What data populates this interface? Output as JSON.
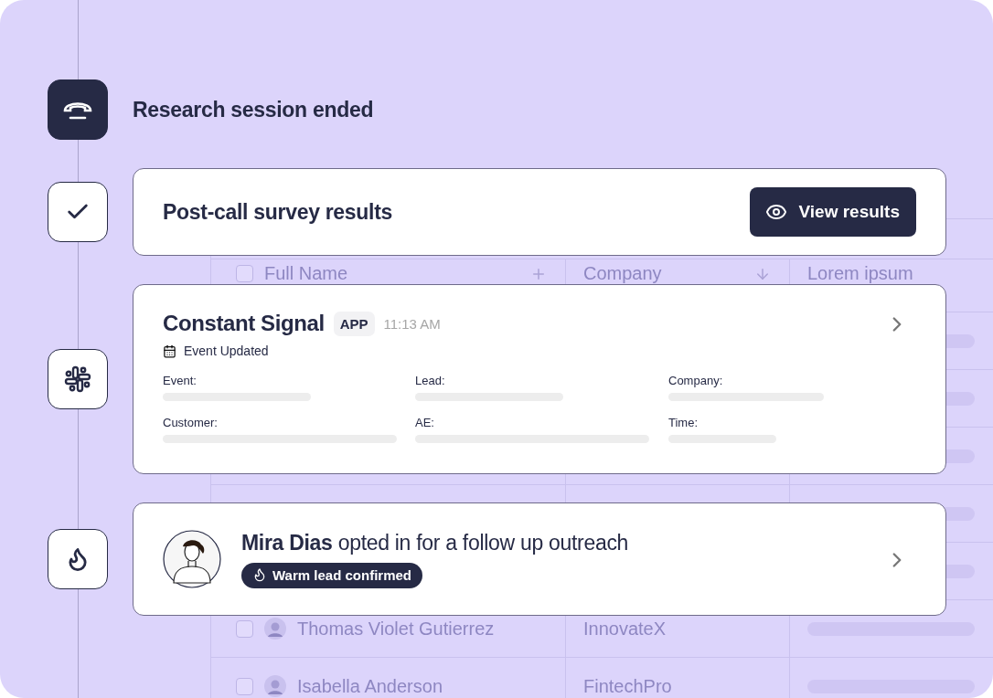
{
  "timeline": [
    {
      "kind": "status",
      "title": "Research session ended"
    },
    {
      "kind": "survey",
      "title": "Post-call survey results",
      "button": "View results"
    },
    {
      "kind": "event",
      "app": "Constant Signal",
      "badge": "APP",
      "time": "11:13 AM",
      "event": "Event Updated",
      "fields": [
        "Event:",
        "Lead:",
        "Company:",
        "Customer:",
        "AE:",
        "Time:"
      ]
    },
    {
      "kind": "lead",
      "message": "**Mira Dias** opted in for a follow up outreach",
      "tag": "Warm lead confirmed"
    }
  ],
  "table": {
    "header_checked": false,
    "columns": [
      {
        "label": "Full Name",
        "kind": "add"
      },
      {
        "label": "Company",
        "kind": "sort"
      },
      {
        "label": "Lorem ipsum",
        "kind": "plain"
      }
    ],
    "rows": [
      {
        "kind": "skeleton"
      },
      {
        "kind": "skeleton"
      },
      {
        "kind": "skeleton"
      },
      {
        "kind": "skeleton"
      },
      {
        "kind": "skeleton"
      },
      {
        "kind": "person",
        "name": "Thomas Violet Gutierrez",
        "company": "InnovateX",
        "checked": false
      },
      {
        "kind": "person",
        "name": "Isabella Anderson",
        "company": "FintechPro",
        "checked": false
      }
    ]
  }
}
